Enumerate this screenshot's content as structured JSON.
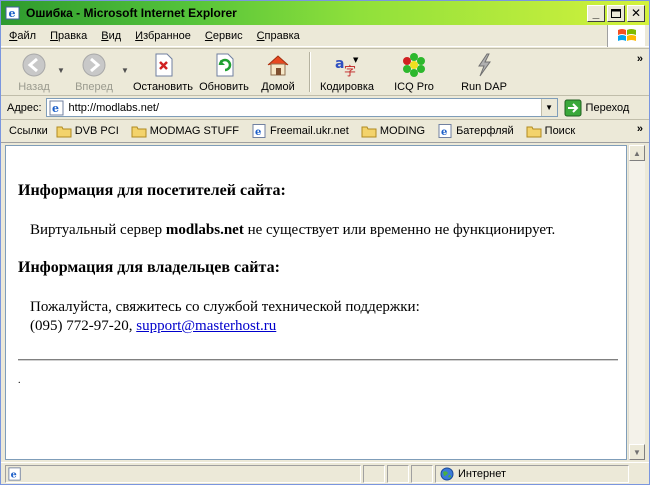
{
  "window": {
    "title": "Ошибка - Microsoft Internet Explorer"
  },
  "menu": [
    {
      "underline": "Ф",
      "rest": "айл"
    },
    {
      "underline": "П",
      "rest": "равка"
    },
    {
      "underline": "В",
      "rest": "ид"
    },
    {
      "underline": "И",
      "rest": "збранное"
    },
    {
      "underline": "С",
      "rest": "ервис"
    },
    {
      "underline": "С",
      "rest": "правка"
    }
  ],
  "toolbar": {
    "back": "Назад",
    "forward": "Вперед",
    "stop": "Остановить",
    "refresh": "Обновить",
    "home": "Домой",
    "encoding": "Кодировка",
    "icq": "ICQ Pro",
    "rundap": "Run DAP"
  },
  "address": {
    "label": "Адрес:",
    "url": "http://modlabs.net/",
    "go": "Переход"
  },
  "links": {
    "label": "Ссылки",
    "items": [
      {
        "label": "DVB PCI",
        "icon": "folder-icon"
      },
      {
        "label": "MODMAG STUFF",
        "icon": "folder-icon"
      },
      {
        "label": "Freemail.ukr.net",
        "icon": "ie-page-icon"
      },
      {
        "label": "MODING",
        "icon": "folder-icon"
      },
      {
        "label": "Батерфляй",
        "icon": "ie-page-icon"
      },
      {
        "label": "Поиск",
        "icon": "folder-icon"
      }
    ]
  },
  "page": {
    "heading_visitors": "Информация для посетителей сайта:",
    "visitors_text_before": "Виртуальный сервер ",
    "visitors_domain": "modlabs.net",
    "visitors_text_after": " не существует или временно не функционирует.",
    "heading_owners": "Информация для владельцев сайта:",
    "owners_text": "Пожалуйста, свяжитесь со службой технической поддержки:",
    "phone": "(095) 772-97-20, ",
    "support_email": "support@masterhost.ru",
    "footer_dot": "."
  },
  "status": {
    "zone": "Интернет"
  },
  "colors": {
    "titlebar_start": "#2E9A2E",
    "titlebar_end": "#D4F23C",
    "link": "#0000CC"
  }
}
